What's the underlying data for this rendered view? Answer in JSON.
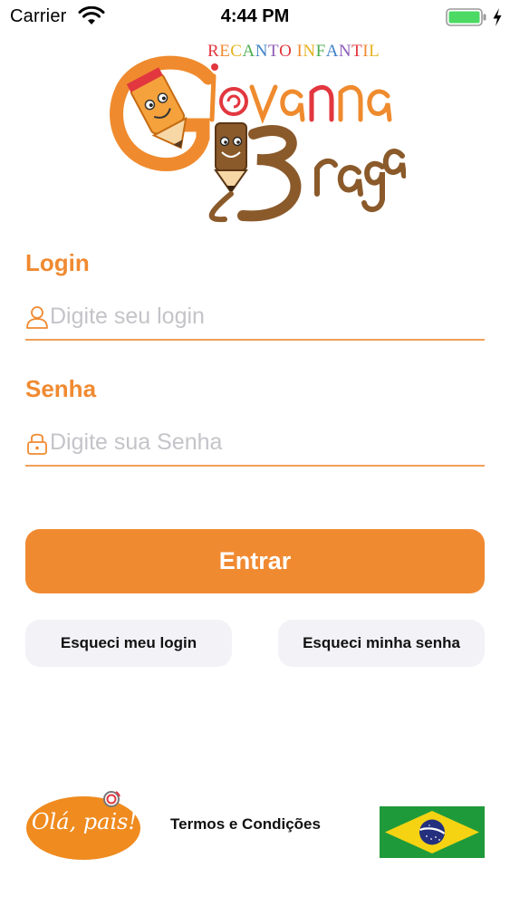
{
  "status_bar": {
    "carrier": "Carrier",
    "time": "4:44 PM",
    "battery_color": "#4cd964"
  },
  "logo": {
    "caption": "RECANTO INFANTIL",
    "caption_colors": [
      "#e2373f",
      "#f08a31",
      "#e6b21d",
      "#4caf50",
      "#3f82c7",
      "#8e5bb5"
    ],
    "name_line1": "Giovanna",
    "name_line2": "Braga"
  },
  "form": {
    "login_label": "Login",
    "login_placeholder": "Digite seu login",
    "login_value": "",
    "password_label": "Senha",
    "password_placeholder": "Digite sua Senha",
    "password_value": "",
    "submit_label": "Entrar"
  },
  "links": {
    "forgot_login": "Esqueci meu login",
    "forgot_password": "Esqueci minha senha"
  },
  "footer": {
    "ola_pais": "Olá, pais!",
    "terms": "Termos e Condições",
    "language_flag": "brazil-flag-icon"
  },
  "colors": {
    "accent": "#f08a31",
    "underline": "#f0a058",
    "placeholder": "#c4c4c9",
    "secondary_button": "#f2f2f7"
  }
}
